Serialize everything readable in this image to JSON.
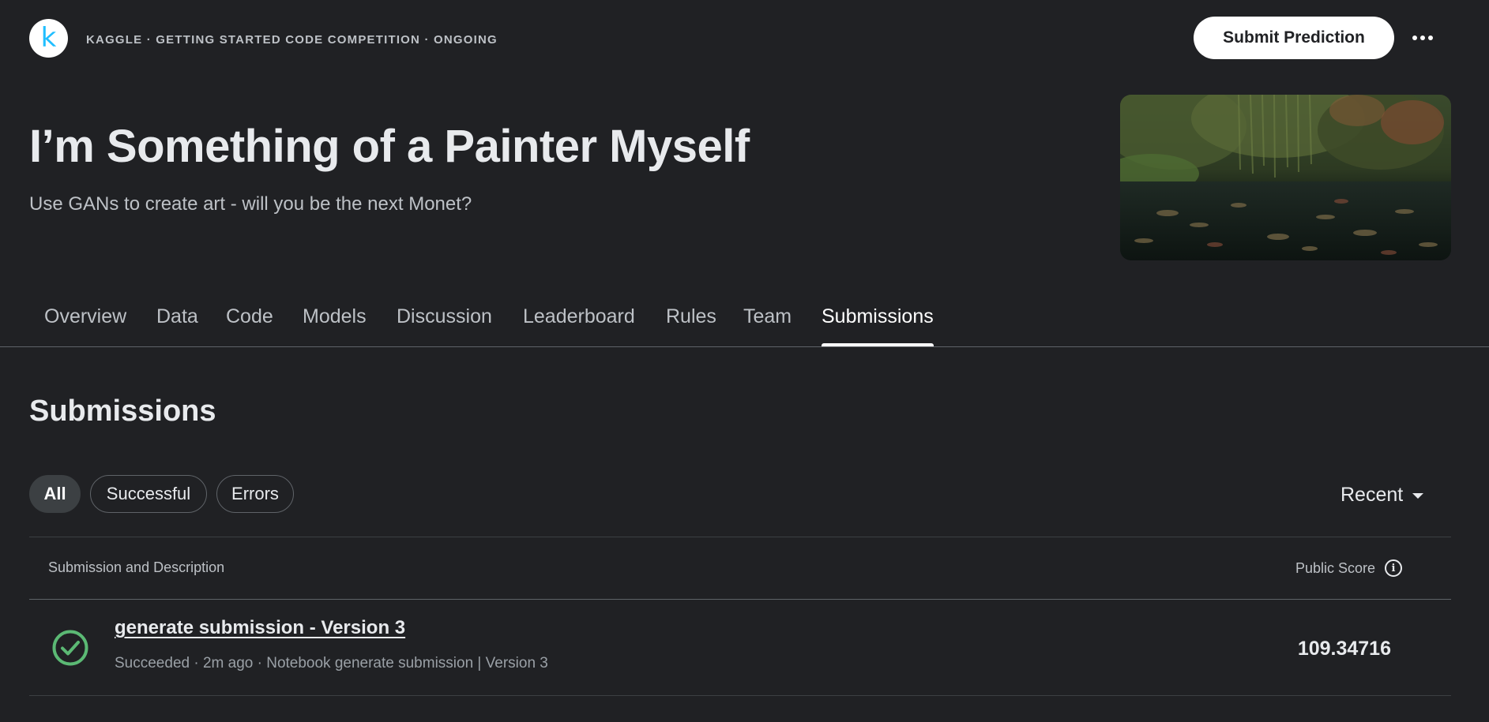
{
  "header": {
    "logo_letter": "k",
    "breadcrumb": "KAGGLE · GETTING STARTED CODE COMPETITION · ONGOING",
    "submit_label": "Submit Prediction",
    "more_icon": "more-horiz-icon"
  },
  "hero": {
    "title": "I’m Something of a Painter Myself",
    "subtitle": "Use GANs to create art - will you be the next Monet?"
  },
  "tabs": [
    {
      "label": "Overview"
    },
    {
      "label": "Data"
    },
    {
      "label": "Code"
    },
    {
      "label": "Models"
    },
    {
      "label": "Discussion"
    },
    {
      "label": "Leaderboard"
    },
    {
      "label": "Rules"
    },
    {
      "label": "Team"
    },
    {
      "label": "Submissions",
      "active": true
    }
  ],
  "submissions": {
    "title": "Submissions",
    "filters": [
      {
        "label": "All",
        "active": true
      },
      {
        "label": "Successful"
      },
      {
        "label": "Errors"
      }
    ],
    "sort": {
      "label": "Recent"
    },
    "table": {
      "col_left": "Submission and Description",
      "col_right": "Public Score",
      "rows": [
        {
          "title": "generate submission - Version 3",
          "meta": "Succeeded · 2m ago · Notebook generate submission | Version 3",
          "score": "109.34716",
          "status_icon": "check-circle-icon"
        }
      ]
    }
  },
  "colors": {
    "background": "#202124",
    "success": "#5bb974",
    "kaggle_blue": "#20beff"
  }
}
